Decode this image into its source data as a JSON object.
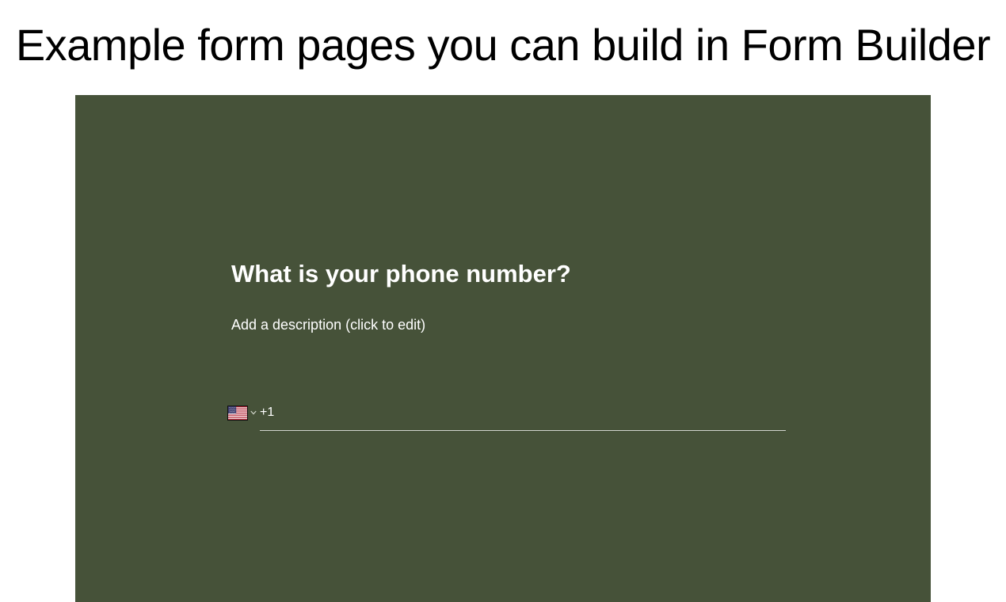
{
  "page": {
    "heading": "Example form pages you can build in Form Builder"
  },
  "form": {
    "question_title": "What is your phone number?",
    "description": "Add a description (click to edit)",
    "country_flag_icon": "us-flag-icon",
    "dropdown_icon": "chevron-down-icon",
    "dial_code": "+1",
    "phone_value": "",
    "phone_placeholder": ""
  },
  "colors": {
    "form_background": "#465239",
    "form_text": "#ffffff",
    "page_background": "#ffffff",
    "heading_text": "#000000"
  }
}
